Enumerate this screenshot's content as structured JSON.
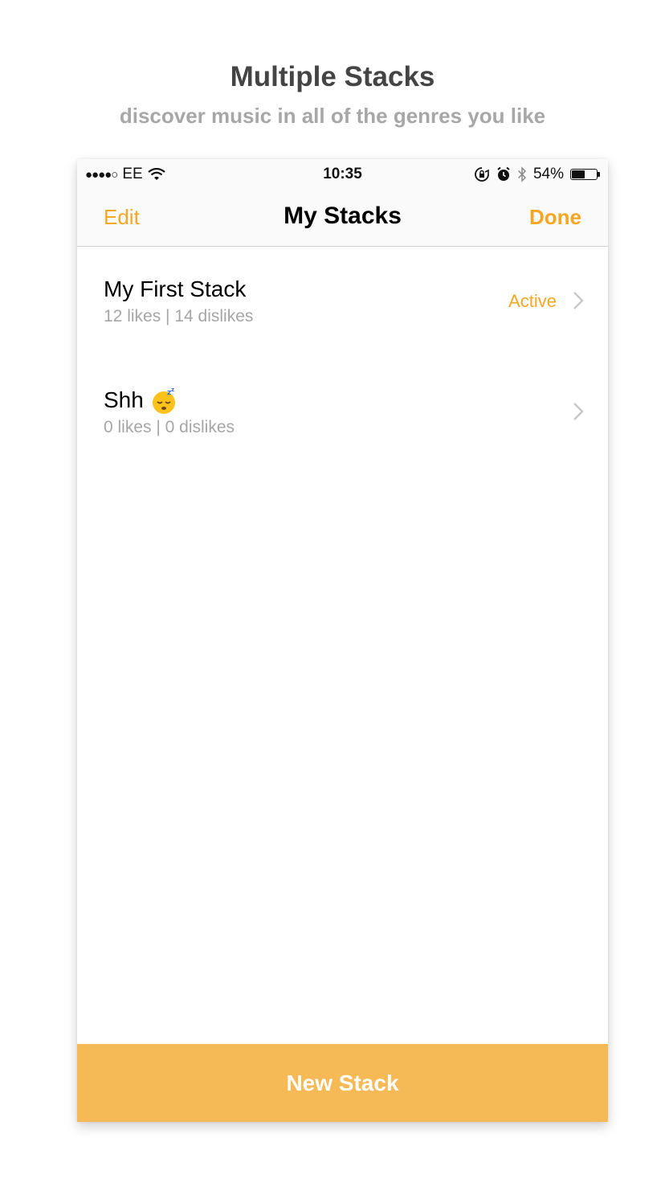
{
  "promo": {
    "title": "Multiple Stacks",
    "subtitle": "discover music in all of the genres you like"
  },
  "status_bar": {
    "signal": "●●●●○",
    "carrier": "EE",
    "time": "10:35",
    "battery_percent": "54%",
    "battery_level": 0.54,
    "icons": [
      "signal-dots-icon",
      "wifi-icon",
      "orientation-lock-icon",
      "alarm-icon",
      "bluetooth-icon",
      "battery-icon"
    ]
  },
  "nav": {
    "edit_label": "Edit",
    "title": "My Stacks",
    "done_label": "Done"
  },
  "stacks": [
    {
      "name": "My First Stack",
      "stats": "12 likes | 14 dislikes",
      "status": "Active"
    },
    {
      "name": "Shh",
      "emoji": "sleeping-face-icon",
      "stats": "0 likes | 0 dislikes",
      "status": ""
    }
  ],
  "footer": {
    "new_stack_label": "New Stack"
  },
  "colors": {
    "accent": "#f5a623",
    "button_bg": "#f5b955",
    "title_text": "#444444",
    "subtitle_text": "#a7a7a7",
    "secondary_text": "#a6a6a6"
  }
}
